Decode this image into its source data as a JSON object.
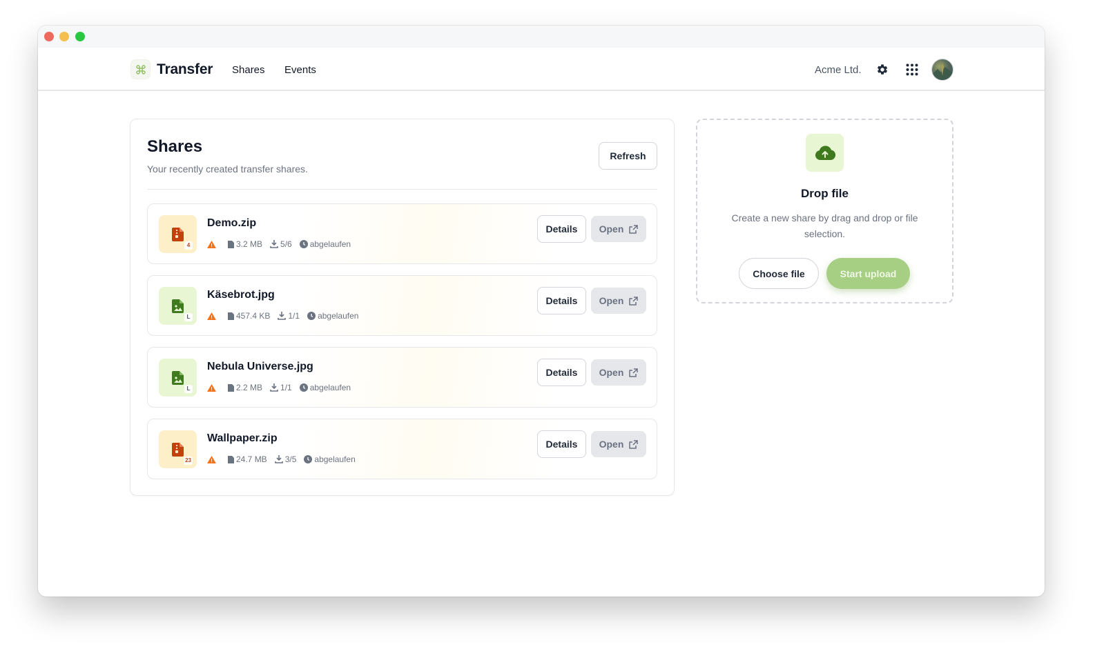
{
  "app": {
    "name": "Transfer"
  },
  "nav": {
    "shares_label": "Shares",
    "events_label": "Events"
  },
  "header": {
    "org": "Acme Ltd."
  },
  "shares": {
    "title": "Shares",
    "subtitle": "Your recently created transfer shares.",
    "refresh_label": "Refresh",
    "details_label": "Details",
    "open_label": "Open",
    "items": [
      {
        "name": "Demo.zip",
        "kind": "zip",
        "badge": "4",
        "size": "3.2 MB",
        "downloads": "5/6",
        "status": "abgelaufen"
      },
      {
        "name": "Käsebrot.jpg",
        "kind": "image",
        "badge": "L",
        "size": "457.4 KB",
        "downloads": "1/1",
        "status": "abgelaufen"
      },
      {
        "name": "Nebula Universe.jpg",
        "kind": "image",
        "badge": "L",
        "size": "2.2 MB",
        "downloads": "1/1",
        "status": "abgelaufen"
      },
      {
        "name": "Wallpaper.zip",
        "kind": "zip",
        "badge": "23",
        "size": "24.7 MB",
        "downloads": "3/5",
        "status": "abgelaufen"
      }
    ]
  },
  "dropzone": {
    "title": "Drop file",
    "description": "Create a new share by drag and drop or file selection.",
    "choose_label": "Choose file",
    "upload_label": "Start upload"
  },
  "colors": {
    "accent_green": "#a7cf84",
    "icon_green": "#3f7a1f",
    "icon_orange": "#c2410c",
    "warning": "#f97316"
  },
  "icons": {
    "logo": "command-icon",
    "settings": "gear-icon",
    "apps": "grid-icon",
    "zip": "file-zip-icon",
    "image": "file-image-icon",
    "warning": "warning-icon",
    "size": "file-icon",
    "downloads": "download-icon",
    "expiry": "clock-icon",
    "open": "external-link-icon",
    "upload": "cloud-upload-icon"
  }
}
